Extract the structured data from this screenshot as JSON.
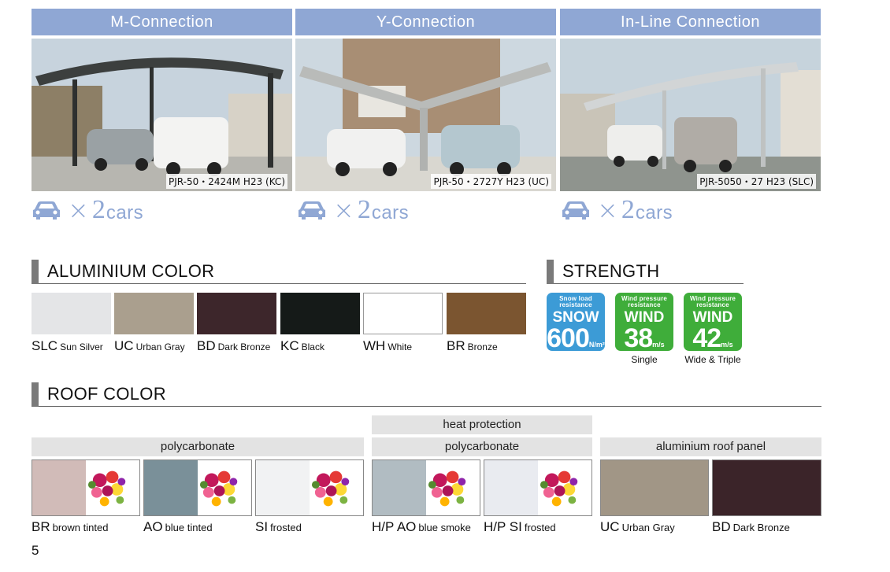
{
  "connections": [
    {
      "title": "M-Connection",
      "model": "PJR-50・2424M H23 (KC)",
      "times": "×",
      "count": "2",
      "unit": "cars"
    },
    {
      "title": "Y-Connection",
      "model": "PJR-50・2727Y H23 (UC)",
      "times": "×",
      "count": "2",
      "unit": "cars"
    },
    {
      "title": "In-Line Connection",
      "model": "PJR-5050・27 H23 (SLC)",
      "times": "×",
      "count": "2",
      "unit": "cars"
    }
  ],
  "aluminium": {
    "heading": "ALUMINIUM COLOR",
    "swatches": [
      {
        "code": "SLC",
        "name": "Sun Silver",
        "color": "#e4e5e7"
      },
      {
        "code": "UC",
        "name": "Urban Gray",
        "color": "#aa9f8e"
      },
      {
        "code": "BD",
        "name": "Dark Bronze",
        "color": "#3d262b"
      },
      {
        "code": "KC",
        "name": "Black",
        "color": "#151a18"
      },
      {
        "code": "WH",
        "name": "White",
        "color": "#ffffff"
      },
      {
        "code": "BR",
        "name": "Bronze",
        "color": "#7b5530"
      }
    ]
  },
  "strength": {
    "heading": "STRENGTH",
    "badges": [
      {
        "line1": "Snow load",
        "line2": "resistance",
        "big": "SNOW",
        "value": "600",
        "unit": "N/m²",
        "caption": ""
      },
      {
        "line1": "Wind pressure",
        "line2": "resistance",
        "big": "WIND",
        "value": "38",
        "unit": "m/s",
        "caption": "Single"
      },
      {
        "line1": "Wind pressure",
        "line2": "resistance",
        "big": "WIND",
        "value": "42",
        "unit": "m/s",
        "caption": "Wide & Triple"
      }
    ]
  },
  "roof": {
    "heading": "ROOF COLOR",
    "groups": {
      "heat_protection": "heat protection",
      "polycarbonate_1": "polycarbonate",
      "polycarbonate_2": "polycarbonate",
      "aluminium_panel": "aluminium roof panel"
    },
    "swatches": [
      {
        "code": "BR",
        "name": "brown tinted",
        "color": "#cdb5b2"
      },
      {
        "code": "AO",
        "name": "blue tinted",
        "color": "#6f8790"
      },
      {
        "code": "SI",
        "name": "frosted",
        "color": "#f0f1f2"
      },
      {
        "code": "H/P AO",
        "name": "blue smoke",
        "color": "#aab6bd"
      },
      {
        "code": "H/P SI",
        "name": "frosted",
        "color": "#e7e9ef"
      },
      {
        "code": "UC",
        "name": "Urban Gray",
        "color": "#a19686"
      },
      {
        "code": "BD",
        "name": "Dark Bronze",
        "color": "#3b2429"
      }
    ]
  },
  "page_number": "5",
  "colors": {
    "accent": "#8fa7d4",
    "snow_badge": "#3c9bd6",
    "wind_badge": "#3fad3a"
  }
}
